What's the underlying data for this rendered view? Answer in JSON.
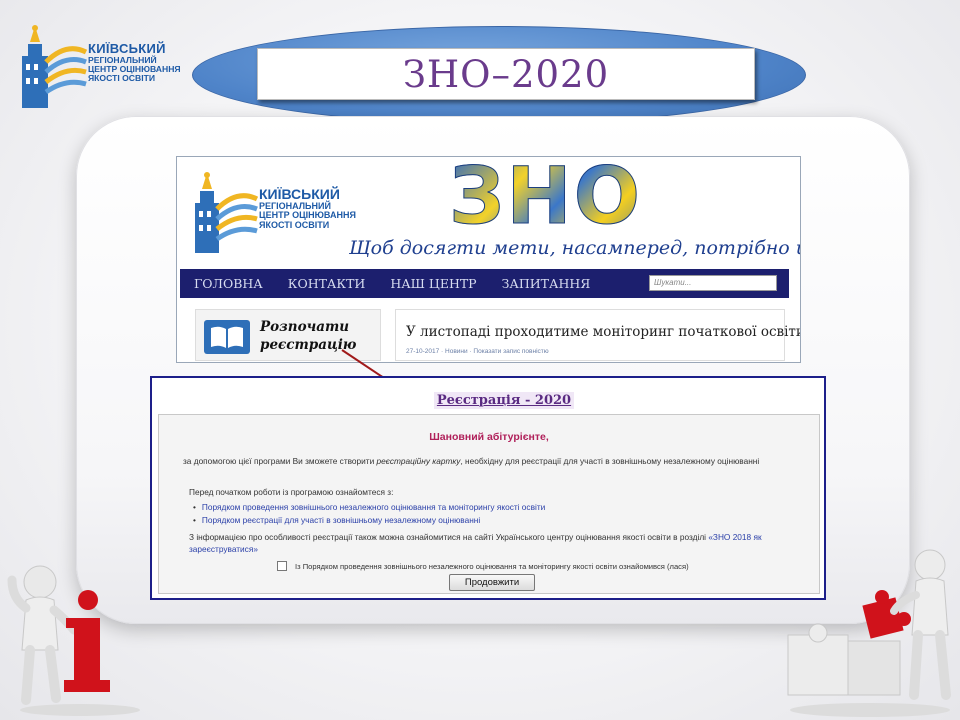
{
  "slide": {
    "logo": {
      "line1": "КИЇВСЬКИЙ",
      "line2": "РЕГІОНАЛЬНИЙ",
      "line3": "ЦЕНТР ОЦІНЮВАННЯ",
      "line4": "ЯКОСТІ ОСВІТИ"
    },
    "title": "ЗНО–2020"
  },
  "website": {
    "logo": {
      "line1": "КИЇВСЬКИЙ",
      "line2": "РЕГІОНАЛЬНИЙ",
      "line3": "ЦЕНТР ОЦІНЮВАННЯ",
      "line4": "ЯКОСТІ ОСВІТИ"
    },
    "banner_word": "ЗНО",
    "slogan": "Щоб досягти мети, насамперед, потрібно йти",
    "nav": [
      "ГОЛОВНА",
      "КОНТАКТИ",
      "НАШ ЦЕНТР",
      "ЗАПИТАННЯ"
    ],
    "search_placeholder": "Шукати...",
    "register_line1": "Розпочати",
    "register_line2": "реєстрацію",
    "news_title": "У листопаді проходитиме моніторинг початкової освіти",
    "news_meta": "27-10-2017 · Новини · Показати запис повністю"
  },
  "registration": {
    "tab_label": "Реєстрація - 2020",
    "greeting": "Шановний абітурієнте,",
    "intro_prefix": "за допомогою цієї програми Ви зможете створити ",
    "intro_em": "реєстраційну картку",
    "intro_suffix": ", необхідну для реєстрації для участі в зовнішньому незалежному оцінюванні",
    "before_start": "Перед початком роботи із програмою ознайомтеся з:",
    "links": [
      "Порядком проведення зовнішнього незалежного оцінювання та моніторингу якості освіти",
      "Порядком реєстрації для участі в зовнішньому незалежному оцінюванні"
    ],
    "info_text": "З інформацією про особливості реєстрації також можна ознайомитися на сайті Українського центру оцінювання якості освіти в розділі ",
    "info_link": "«ЗНО 2018 як зареєструватися»",
    "checkbox_label": "Із Порядком проведення зовнішнього незалежного оцінювання та моніторингу якості освіти ознайомився (лася)",
    "continue_button": "Продовжити"
  },
  "colors": {
    "title_text": "#6a3b8c",
    "ellipse": "#4f84c9",
    "nav_bg": "#1c1f6e",
    "greeting": "#b0205a",
    "link": "#2a3fa8",
    "arrow": "#a01a1a"
  }
}
